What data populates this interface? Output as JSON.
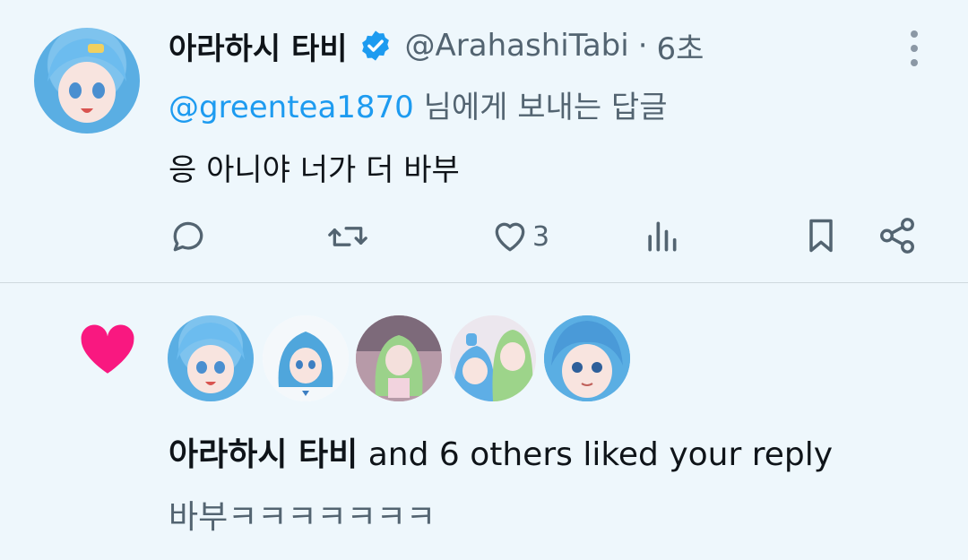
{
  "tweet": {
    "display_name": "아라하시 타비",
    "handle": "@ArahashiTabi",
    "separator": "·",
    "time": "6초",
    "reply_to_mention": "@greentea1870",
    "reply_to_suffix": " 님에게 보내는 답글",
    "text": "응 아니야 너가 더 바부",
    "like_count": "3"
  },
  "notification": {
    "liker_name": "아라하시 타비",
    "summary_suffix": " and 6 others liked your reply",
    "reply_preview": "바부ㅋㅋㅋㅋㅋㅋㅋ"
  },
  "colors": {
    "accent": "#1d9bf0",
    "like_pink": "#f91880",
    "muted": "#536471",
    "background": "#eef7fc"
  },
  "icons": [
    "verified-badge-icon",
    "more-icon",
    "reply-icon",
    "retweet-icon",
    "like-icon",
    "views-icon",
    "bookmark-icon",
    "share-icon",
    "heart-filled-icon"
  ]
}
